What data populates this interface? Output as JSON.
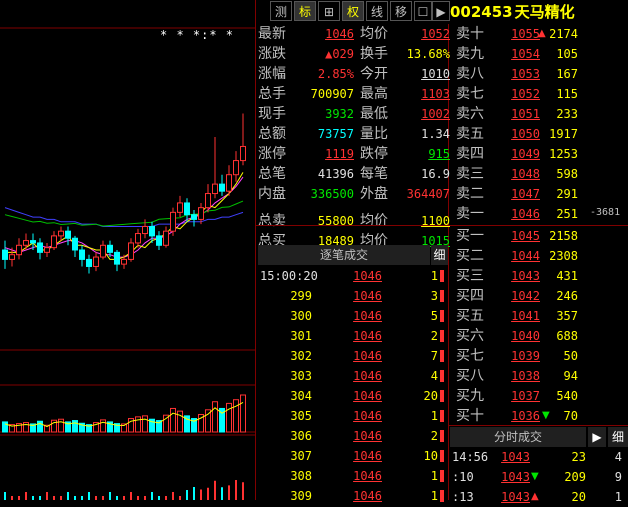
{
  "toolbar": {
    "buttons": [
      "测",
      "标",
      "⊞",
      "权",
      "线",
      "移",
      "☐",
      "▶"
    ],
    "stock_code": "002453",
    "stock_name": "天马精化"
  },
  "chart_dots": "* * *:*  *",
  "quote": {
    "rows": [
      {
        "l1": "最新",
        "v1": "1046",
        "c1": "red",
        "u1": true,
        "l2": "均价",
        "v2": "1052",
        "c2": "red",
        "u2": true
      },
      {
        "l1": "涨跌",
        "v1": "▲029",
        "c1": "red",
        "u1": false,
        "l2": "换手",
        "v2": "13.68%",
        "c2": "yellow",
        "u2": false
      },
      {
        "l1": "涨幅",
        "v1": "2.85%",
        "c1": "red",
        "u1": false,
        "l2": "今开",
        "v2": "1010",
        "c2": "white",
        "u2": true
      },
      {
        "l1": "总手",
        "v1": "700907",
        "c1": "yellow",
        "u1": false,
        "l2": "最高",
        "v2": "1103",
        "c2": "red",
        "u2": true
      },
      {
        "l1": "现手",
        "v1": "3932",
        "c1": "green",
        "u1": false,
        "l2": "最低",
        "v2": "1002",
        "c2": "red",
        "u2": true
      },
      {
        "l1": "总额",
        "v1": "73757",
        "c1": "cyan",
        "u1": false,
        "l2": "量比",
        "v2": "1.34",
        "c2": "white",
        "u2": false
      },
      {
        "l1": "涨停",
        "v1": "1119",
        "c1": "red",
        "u1": true,
        "l2": "跌停",
        "v2": "915",
        "c2": "green",
        "u2": true
      },
      {
        "l1": "总笔",
        "v1": "41396",
        "c1": "white",
        "u1": false,
        "l2": "每笔",
        "v2": "16.9",
        "c2": "white",
        "u2": false
      },
      {
        "l1": "内盘",
        "v1": "336500",
        "c1": "green",
        "u1": false,
        "l2": "外盘",
        "v2": "364407",
        "c2": "red",
        "u2": false
      },
      {
        "l1": "总卖",
        "v1": "55800",
        "c1": "yellow",
        "u1": false,
        "l2": "均价",
        "v2": "1100",
        "c2": "yellow",
        "u2": true
      },
      {
        "l1": "总买",
        "v1": "18489",
        "c1": "yellow",
        "u1": false,
        "l2": "均价",
        "v2": "1015",
        "c2": "green",
        "u2": true
      }
    ]
  },
  "asks": [
    {
      "label": "卖十",
      "price": "1055",
      "vol": "2174",
      "arrow": "up"
    },
    {
      "label": "卖九",
      "price": "1054",
      "vol": "105",
      "arrow": ""
    },
    {
      "label": "卖八",
      "price": "1053",
      "vol": "167",
      "arrow": ""
    },
    {
      "label": "卖七",
      "price": "1052",
      "vol": "115",
      "arrow": ""
    },
    {
      "label": "卖六",
      "price": "1051",
      "vol": "233",
      "arrow": ""
    },
    {
      "label": "卖五",
      "price": "1050",
      "vol": "1917",
      "arrow": ""
    },
    {
      "label": "卖四",
      "price": "1049",
      "vol": "1253",
      "arrow": ""
    },
    {
      "label": "卖三",
      "price": "1048",
      "vol": "598",
      "arrow": ""
    },
    {
      "label": "卖二",
      "price": "1047",
      "vol": "291",
      "arrow": ""
    },
    {
      "label": "卖一",
      "price": "1046",
      "vol": "251",
      "arrow": ""
    }
  ],
  "ask1_change": "-3681",
  "bids": [
    {
      "label": "买一",
      "price": "1045",
      "vol": "2158",
      "arrow": ""
    },
    {
      "label": "买二",
      "price": "1044",
      "vol": "2308",
      "arrow": ""
    },
    {
      "label": "买三",
      "price": "1043",
      "vol": "431",
      "arrow": ""
    },
    {
      "label": "买四",
      "price": "1042",
      "vol": "246",
      "arrow": ""
    },
    {
      "label": "买五",
      "price": "1041",
      "vol": "357",
      "arrow": ""
    },
    {
      "label": "买六",
      "price": "1040",
      "vol": "688",
      "arrow": ""
    },
    {
      "label": "买七",
      "price": "1039",
      "vol": "50",
      "arrow": ""
    },
    {
      "label": "买八",
      "price": "1038",
      "vol": "94",
      "arrow": ""
    },
    {
      "label": "买九",
      "price": "1037",
      "vol": "540",
      "arrow": ""
    },
    {
      "label": "买十",
      "price": "1036",
      "vol": "70",
      "arrow": "down"
    }
  ],
  "ticks": {
    "header": "逐笔成交",
    "header_btn": "细",
    "first_time": "15:00:20",
    "rows": [
      {
        "idx": "",
        "price": "1046",
        "vol": "1"
      },
      {
        "idx": "299",
        "price": "1046",
        "vol": "3"
      },
      {
        "idx": "300",
        "price": "1046",
        "vol": "5"
      },
      {
        "idx": "301",
        "price": "1046",
        "vol": "2"
      },
      {
        "idx": "302",
        "price": "1046",
        "vol": "7"
      },
      {
        "idx": "303",
        "price": "1046",
        "vol": "4"
      },
      {
        "idx": "304",
        "price": "1046",
        "vol": "20"
      },
      {
        "idx": "305",
        "price": "1046",
        "vol": "1"
      },
      {
        "idx": "306",
        "price": "1046",
        "vol": "2"
      },
      {
        "idx": "307",
        "price": "1046",
        "vol": "10"
      },
      {
        "idx": "308",
        "price": "1046",
        "vol": "1"
      },
      {
        "idx": "309",
        "price": "1046",
        "vol": "1"
      }
    ]
  },
  "minute": {
    "header": "分时成交",
    "play_btn": "▶",
    "detail_btn": "细",
    "rows": [
      {
        "time": "14:56",
        "price": "1043",
        "vol": "23",
        "cnt": "4",
        "arrow": ""
      },
      {
        "time": ":10",
        "price": "1043",
        "vol": "209",
        "cnt": "9",
        "arrow": "down"
      },
      {
        "time": ":13",
        "price": "1043",
        "vol": "20",
        "cnt": "1",
        "arrow": "up"
      }
    ]
  },
  "chart_data": {
    "type": "candlestick",
    "title": "",
    "candles": [
      {
        "o": 1002,
        "c": 998,
        "h": 1006,
        "l": 994
      },
      {
        "o": 998,
        "c": 1000,
        "h": 1003,
        "l": 995
      },
      {
        "o": 1000,
        "c": 1004,
        "h": 1007,
        "l": 998
      },
      {
        "o": 1004,
        "c": 1006,
        "h": 1009,
        "l": 1002
      },
      {
        "o": 1006,
        "c": 1005,
        "h": 1009,
        "l": 1002
      },
      {
        "o": 1005,
        "c": 1001,
        "h": 1007,
        "l": 998
      },
      {
        "o": 1001,
        "c": 1003,
        "h": 1005,
        "l": 999
      },
      {
        "o": 1003,
        "c": 1008,
        "h": 1010,
        "l": 1002
      },
      {
        "o": 1008,
        "c": 1010,
        "h": 1012,
        "l": 1006
      },
      {
        "o": 1010,
        "c": 1007,
        "h": 1012,
        "l": 1004
      },
      {
        "o": 1007,
        "c": 1002,
        "h": 1008,
        "l": 999
      },
      {
        "o": 1002,
        "c": 998,
        "h": 1004,
        "l": 995
      },
      {
        "o": 998,
        "c": 995,
        "h": 1000,
        "l": 992
      },
      {
        "o": 995,
        "c": 999,
        "h": 1001,
        "l": 993
      },
      {
        "o": 999,
        "c": 1004,
        "h": 1006,
        "l": 998
      },
      {
        "o": 1004,
        "c": 1001,
        "h": 1006,
        "l": 999
      },
      {
        "o": 1001,
        "c": 996,
        "h": 1002,
        "l": 993
      },
      {
        "o": 996,
        "c": 998,
        "h": 1000,
        "l": 994
      },
      {
        "o": 998,
        "c": 1005,
        "h": 1007,
        "l": 997
      },
      {
        "o": 1005,
        "c": 1009,
        "h": 1011,
        "l": 1003
      },
      {
        "o": 1009,
        "c": 1012,
        "h": 1015,
        "l": 1007
      },
      {
        "o": 1012,
        "c": 1008,
        "h": 1014,
        "l": 1005
      },
      {
        "o": 1008,
        "c": 1004,
        "h": 1010,
        "l": 1002
      },
      {
        "o": 1004,
        "c": 1010,
        "h": 1012,
        "l": 1003
      },
      {
        "o": 1010,
        "c": 1018,
        "h": 1020,
        "l": 1008
      },
      {
        "o": 1018,
        "c": 1022,
        "h": 1025,
        "l": 1016
      },
      {
        "o": 1022,
        "c": 1017,
        "h": 1024,
        "l": 1014
      },
      {
        "o": 1017,
        "c": 1015,
        "h": 1019,
        "l": 1012
      },
      {
        "o": 1015,
        "c": 1020,
        "h": 1022,
        "l": 1013
      },
      {
        "o": 1020,
        "c": 1026,
        "h": 1030,
        "l": 1018
      },
      {
        "o": 1026,
        "c": 1030,
        "h": 1050,
        "l": 1024
      },
      {
        "o": 1030,
        "c": 1027,
        "h": 1034,
        "l": 1025
      },
      {
        "o": 1027,
        "c": 1034,
        "h": 1038,
        "l": 1025
      },
      {
        "o": 1034,
        "c": 1040,
        "h": 1044,
        "l": 1031
      },
      {
        "o": 1040,
        "c": 1046,
        "h": 1060,
        "l": 1038
      }
    ],
    "ma_short": [
      1003,
      1002,
      1001,
      1002,
      1003,
      1004,
      1003,
      1004,
      1005,
      1006,
      1006,
      1005,
      1003,
      1001,
      1000,
      1000,
      999,
      999,
      1000,
      1002,
      1005,
      1007,
      1007,
      1008,
      1010,
      1013,
      1015,
      1016,
      1017,
      1019,
      1022,
      1024,
      1026,
      1029,
      1033
    ],
    "ma_long": [
      1020,
      1019,
      1018,
      1017,
      1016,
      1016,
      1015,
      1015,
      1014,
      1014,
      1014,
      1013,
      1013,
      1013,
      1012,
      1012,
      1012,
      1012,
      1012,
      1012,
      1012,
      1012,
      1013,
      1013,
      1013,
      1013,
      1014,
      1014,
      1014,
      1015,
      1015,
      1016,
      1016,
      1017,
      1018
    ],
    "volume": [
      30,
      22,
      25,
      28,
      24,
      32,
      20,
      35,
      38,
      30,
      34,
      26,
      22,
      28,
      36,
      30,
      25,
      24,
      40,
      45,
      48,
      38,
      34,
      50,
      70,
      62,
      48,
      40,
      52,
      66,
      90,
      70,
      85,
      96,
      110
    ],
    "price_range": [
      985,
      1070
    ]
  }
}
